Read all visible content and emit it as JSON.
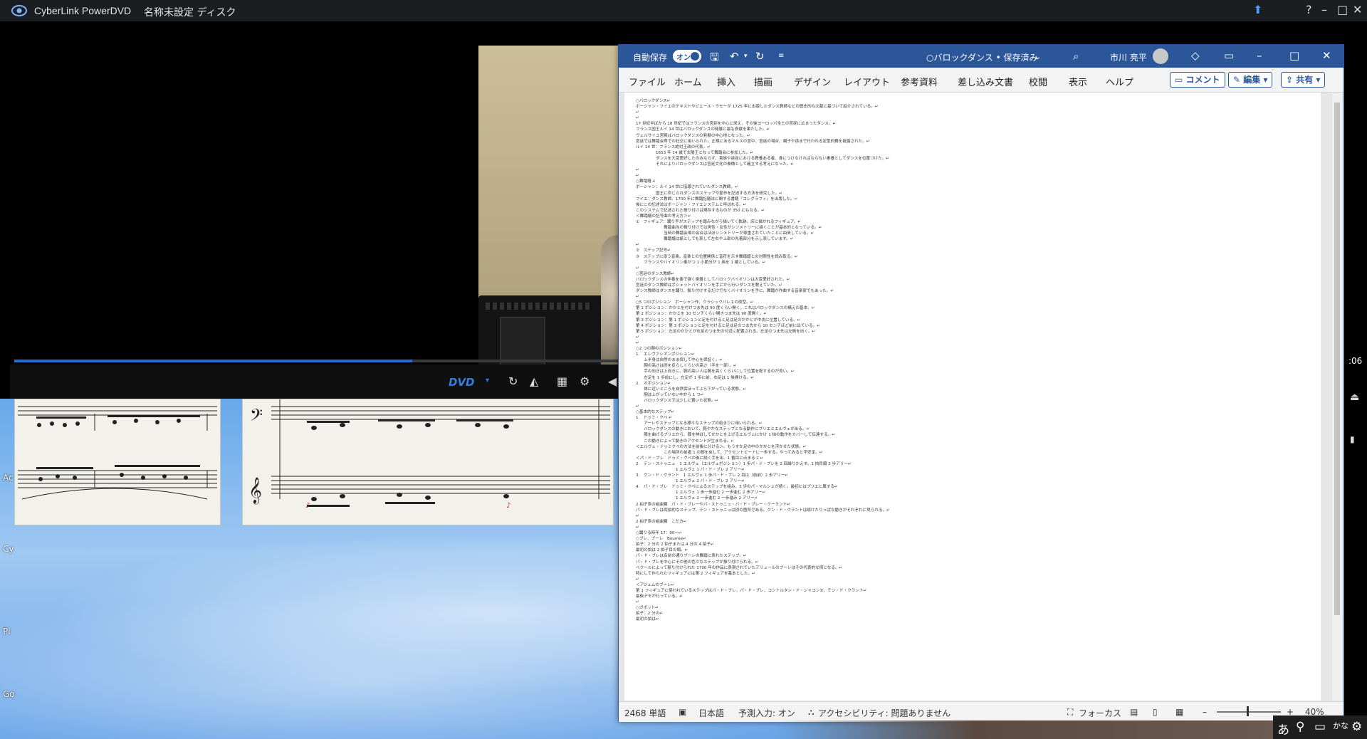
{
  "powerdvd": {
    "app_name": "CyberLink PowerDVD",
    "disc_title": "名称未設定 ディスク",
    "source_label": "DVD",
    "time_fragment": ":06",
    "progress": 0.44
  },
  "desktop": {
    "icon_labels_partial": [
      "Ac",
      "Cy",
      "Pl",
      "Go"
    ]
  },
  "word": {
    "autosave_label": "自動保存",
    "autosave_state": "オン",
    "doc_title": "○バロックダンス • 保存済み",
    "user_name": "市川 亮平",
    "tabs": [
      "ファイル",
      "ホーム",
      "挿入",
      "描画",
      "デザイン",
      "レイアウト",
      "参考資料",
      "差し込み文書",
      "校閲",
      "表示",
      "ヘルプ"
    ],
    "comment_button": "コメント",
    "edit_button": "編集",
    "share_button": "共有",
    "status": {
      "word_count": "2468 単語",
      "language": "日本語",
      "predictive": "予測入力: オン",
      "accessibility": "アクセシビリティ: 問題ありません",
      "focus": "フォーカス",
      "zoom": "40%"
    },
    "document_lines": [
      "○バロックダンス↵",
      "ボーシャン・フイエのテキストやピエール・ラモーが 1725 年に出版したダンス教師などの歴史的な文献に基づいて紹介されている。↵",
      "↵",
      "↵",
      "17 世紀半ばから 18 世紀ではフランスの宮廷を中心に栄え、その後ヨーロッパ全土の宮廷に広まったダンス。↵",
      "フランス国王ルイ 14 世はバロックダンスの発展に最も貢献を果たした。↵",
      "ヴェルサイユ宮殿はバロックダンスの発展の中心地となった。↵",
      "宮廷では舞踏会等での社交に用いられた。正規にあるマルスの宮中、宮廷の場合、親子や孫まで行われる定型的舞を披露された。↵",
      "ルイ 14 世：フランス絶対王政の代表。↵",
      "　　　　　1653 年 14 歳で太陽王となって舞踏会に参加した。↵",
      "　　　　　ダンスを大変愛好したのみならず、貴族や廷臣における教養ある者、身につけなければならない素養としてダンスを位置づけた。↵",
      "　　　　　それによりバロックダンスは宮廷文化の象徴として確立する考えになった。↵",
      "↵",
      "↵",
      "○舞踏譜 ↵",
      "ボーシャン：ルイ 14 世に指導されていたダンス教師。↵",
      "　　　　　国王に命じられダンスのステップや動作を記述する方法を研究した。↵",
      "フイエ：ダンス教師。1700 年に舞踏記譜法に関する書籍『コレグラフィ』を出版した。↵",
      "後にこの記述法はボーシャン・フイエシステムと呼ばれる。↵",
      "このシステムで記述された振り付けは現存するものが 350 にもなる。↵",
      "＜舞踏譜の記号曲の考え方＞↵",
      "①　フィギュア：踊り手がステップを踏みながら描いてく軌跡。床に描かれるフィギュア。↵",
      "　　　　　　　舞踏曲当の振り付けでは男性・女性がシンメトリーに描くことが基本的となっている。↵",
      "　　　　　　　当時の舞踏会場の会合はほぼシンメトリーが尊重されていたことに由来している。↵",
      "　　　　　　　舞踏譜は紙としても表して左右や上部の先着部分を示し表しています。↵",
      "↵",
      "②　ステップ記号↵",
      "③　ステップに添う音楽。音楽との位置関係と音符を示す舞踏譜との対照性を読み取る。↵",
      "　　フランスやバイオリン奏がつ 1 小節分が 1 画を 1 線としている。↵",
      "↵",
      "○宮廷のダンス教師↵",
      "バロックダンスの伴奏を奏で弾く楽器としてバロックバイオリンは大変愛好された。↵",
      "宮廷のダンス教師はポシェットバイオリンを手にから行いダンスを教えていた。↵",
      "ダンス教師はダンスを踊り、振り付けするだけでなくバイオリンを手に、舞踏が作曲する音楽家でもあった。↵",
      "↵",
      "○5 つのポジション　ボーシャン作、クラシックバレエの原型。↵",
      "第 1 ポジション：かかとを付けつま先は 90 度くらい開く。これはバロックダンスの構えの基本。↵",
      "第 2 ポジション：かかとを 10 センチくらい開きつま先は 90 度開く。↵",
      "第 3 ポジション：第 1 ポジションと足を付けると足は足のかかとが中央に位置している。↵",
      "第 4 ポジション：第 3 ポジションと足を付けると足は足のつま先から 10 センチほど前に出ている。↵",
      "第 5 ポジション：左足のかかとが右足のつま先の付近に配置される。左足のつま先は左側を向く。↵",
      "↵",
      "↵",
      "○2 つの腕のポジション↵",
      "1.　エレヴァシオンポジション↵",
      "　　上半身は自然のまま保して中心を保証く。↵",
      "　　腕の高さは肘を反らしくらいの高さ（手を一部）。↵",
      "　　手の向きは上向きに、腕の高い人は腕を高くくらいにして位置を配するのが良い。↵",
      "　　左足を 1 歩前にし、左足が 1 歩に前、右足は 1 後開ける。↵",
      "2.　オポジション↵",
      "　　体に近いところを自然保ほってぶら下がっている状態。↵",
      "　　腕は上がっていない中から 1 つ↵",
      "　　バロックダンスでは少しに置いた状態。↵",
      "↵",
      "○基本的なステップ↵",
      "1.　ドゥミ・クペ ↵",
      "　　アーレやステップとなる様々なステップの始まりに用いられる。↵",
      "　　バロックダンスの動きにおいて、軽やかなステップとなる動作にプリエとエルヴェがある。↵",
      "　　膝を曲げるプリエから、膝を伸ばしてかかとを上げるエルヴェにかけ 1 拍の動作をカバーして伝達する。↵",
      "　　この動きによって動きのアクセントが生まれる。↵",
      "＜エルヴェ・ドゥミクペの方法を前後に分ける＞。もうすか足の中のかかとを浮かせた状態。↵",
      "　　　　　　　この場所の前者 1 の脚を戻して、アクセントビートに一歩する。やってみると不安定。↵",
      "＜パ・ド・ブレ　ドゥミ・クペの後に続く手を出、1 番目に点まる 2 ↵",
      "2.　テン・ストゥニュ　1 エルヴェ（エルヴェポジション）1 歩パ・ド・ブレを 2 回繰りかえす。1 拍目順 2 歩アリー↵",
      "　　　　　　　　　　1 エルヴェ 1 パ・ド・ブレ 2 アリー↵",
      "3.　クン・ド・クラント　1 エルヴェ 1 歩パ・ド・ブレ 2 目は（前前）2 歩アリー↵",
      "　　　　　　　　　　1 エルヴェ 2 パ・ド・ブレ 2 アリー↵",
      "4.　パ・ド・ブレ　ドゥミ・クペによるステップを組み、3 歩のパ・マルシェが続く。最初にはプリエに属する↵",
      "　　　　　　　　　　1 エルヴェ 1 歩一歩進む 2 一歩進む 2 歩アリー↵",
      "　　　　　　　　　　1 エルヴェ 2 一歩進む 2 一歩進み 2 アリー↵",
      "2 拍子系の組曲類　パ・ド・ブレーやパ・ストゥニュ・パ・ド・ブレー・クーラント↵",
      "パ・ド・ブレは両拍的なステップ、テン・ストゥニュは別の箇所である。クン・ド・クラントは続けたりっぱな動きがそれぞれに見られる。↵",
      "↵",
      "2 拍子系の組曲類　こだ方↵",
      "↵",
      "○踊りる時年 17：00～↵",
      "○ブレ、ブーレ　Bourree↵",
      "拍子：2 分の 2 拍子または 4 分の 4 拍子↵",
      "最初の拍は 2 拍子目の頭。↵",
      "パ・ド・ブレは名前の通りブーレの舞踏に表れたステップ。↵",
      "パ・ド・ブレを中心にその他の色々なステップが振り付けられる。↵",
      "ペクールによって振り付けられた 1700 年の作品に表現されていたアリュールのブーレはその代表的な例となる。↵",
      "特にして作られたフィギュアには第 2 フィギュアを基本とした。↵",
      "↵",
      "＜アジュムのブーレ↵",
      "第 1 フィギュアに使われているステップはパ・ド・ブレ、パ・ド・ブレ、コントルタン・ド・シャコンヌ、テン・ド・クラント↵",
      "最後デモが行っている。↵",
      "↵",
      "○ガボット↵",
      "拍子：2 分の↵",
      "最初の拍は↵"
    ]
  }
}
